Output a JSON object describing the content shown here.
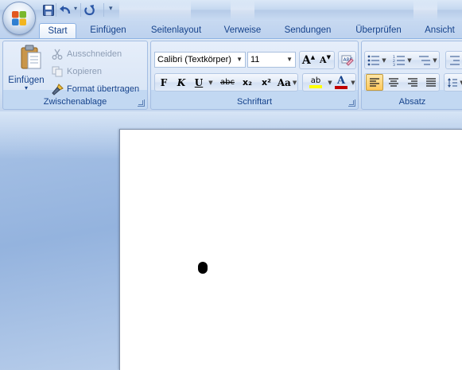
{
  "quick_access": {
    "save_icon": "save-icon",
    "undo_icon": "undo-icon",
    "redo_icon": "redo-icon",
    "customize_icon": "customize-qat-icon"
  },
  "tabs": [
    {
      "label": "Start",
      "active": true
    },
    {
      "label": "Einfügen",
      "active": false
    },
    {
      "label": "Seitenlayout",
      "active": false
    },
    {
      "label": "Verweise",
      "active": false
    },
    {
      "label": "Sendungen",
      "active": false
    },
    {
      "label": "Überprüfen",
      "active": false
    },
    {
      "label": "Ansicht",
      "active": false
    }
  ],
  "clipboard": {
    "group_label": "Zwischenablage",
    "paste_label": "Einfügen",
    "cut_label": "Ausschneiden",
    "copy_label": "Kopieren",
    "format_painter_label": "Format übertragen"
  },
  "font": {
    "group_label": "Schriftart",
    "font_name": "Calibri (Textkörper)",
    "font_size": "11",
    "bold_label": "F",
    "italic_label": "K",
    "underline_label": "U",
    "strike_label": "abc",
    "subscript_label": "x₂",
    "superscript_label": "x²",
    "case_label": "Aa",
    "highlight_label": "ab",
    "font_color_label": "A",
    "grow_label": "A",
    "shrink_label": "A",
    "highlight_color": "#ffff00",
    "font_color": "#c00000"
  },
  "paragraph": {
    "group_label": "Absatz"
  },
  "colors": {
    "accent": "#15428b",
    "active_align": "#ffd67a"
  }
}
